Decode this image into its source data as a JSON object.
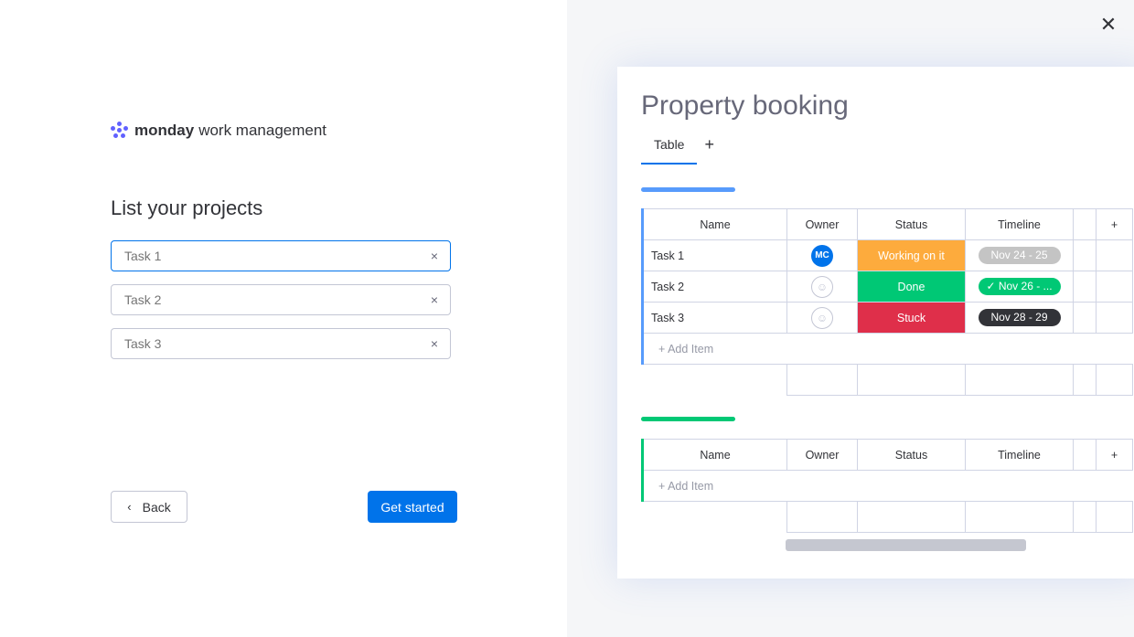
{
  "logo": {
    "brand": "monday",
    "product": "work management"
  },
  "onboarding": {
    "heading": "List your projects",
    "tasks": [
      {
        "value": "",
        "placeholder": "Task 1"
      },
      {
        "value": "",
        "placeholder": "Task 2"
      },
      {
        "value": "",
        "placeholder": "Task 3"
      }
    ],
    "clear_icon": "×",
    "back_label": "Back",
    "back_icon": "‹",
    "start_label": "Get started"
  },
  "preview": {
    "close_icon": "✕",
    "title": "Property booking",
    "tab_label": "Table",
    "tab_add": "+",
    "columns": [
      "Name",
      "Owner",
      "Status",
      "Timeline"
    ],
    "add_col": "+",
    "rows": [
      {
        "name": "Task 1",
        "owner": "MC",
        "status": "Working on it",
        "status_color": "#fdab3d",
        "timeline": "Nov 24 - 25",
        "timeline_bg": "#c4c4c4",
        "timeline_color": "#ffffff"
      },
      {
        "name": "Task 2",
        "owner": "",
        "status": "Done",
        "status_color": "#00c875",
        "timeline": "✓ Nov 26 - ...",
        "timeline_bg": "#00c875",
        "timeline_color": "#ffffff"
      },
      {
        "name": "Task 3",
        "owner": "",
        "status": "Stuck",
        "status_color": "#df2f4a",
        "timeline": "Nov 28 - 29",
        "timeline_bg": "#323338",
        "timeline_color": "#ffffff"
      }
    ],
    "add_item": "+ Add Item",
    "group1_color": "#579bfc",
    "group2_color": "#00c875",
    "owner_color": "#0073ea"
  }
}
